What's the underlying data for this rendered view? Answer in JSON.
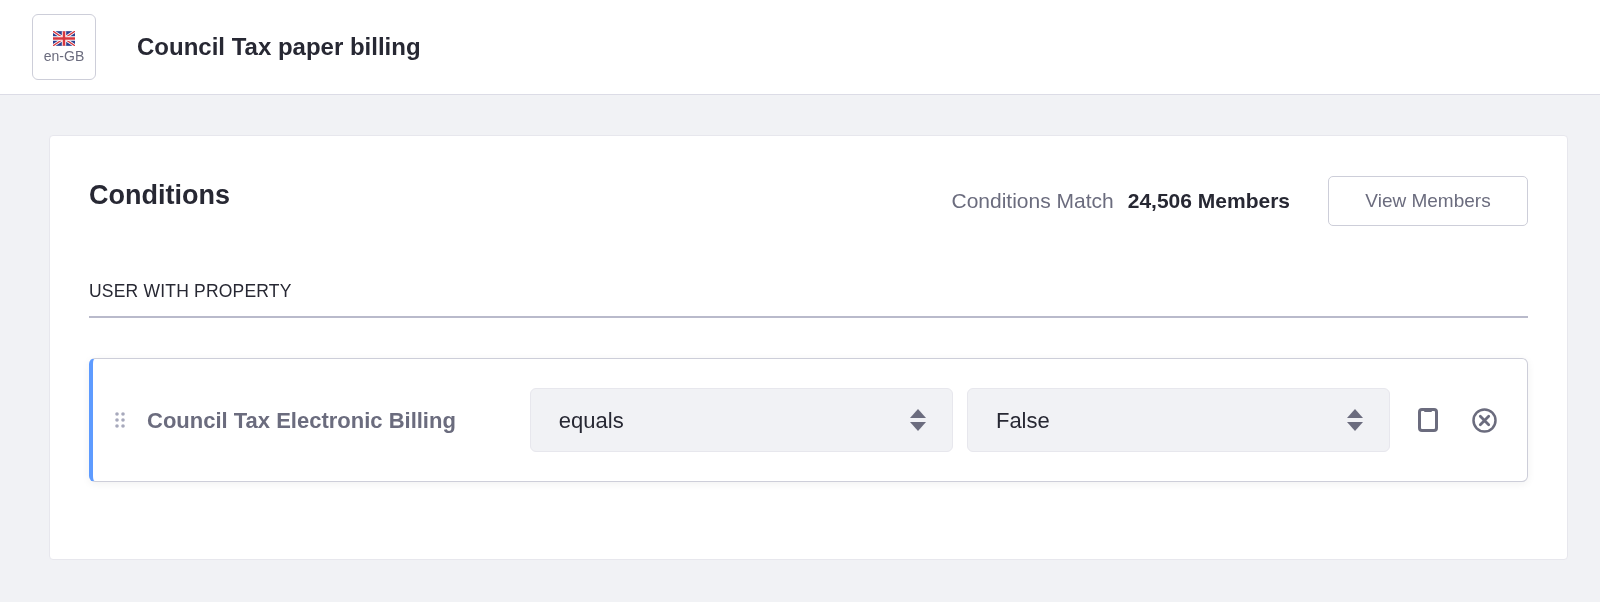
{
  "header": {
    "locale_label": "en-GB",
    "title": "Council Tax paper billing"
  },
  "conditions": {
    "title": "Conditions",
    "match_label": "Conditions Match",
    "match_count": "24,506 Members",
    "view_button": "View Members"
  },
  "group": {
    "title": "USER WITH PROPERTY",
    "criteria": [
      {
        "property": "Council Tax Electronic Billing",
        "operator": "equals",
        "value": "False"
      }
    ]
  }
}
